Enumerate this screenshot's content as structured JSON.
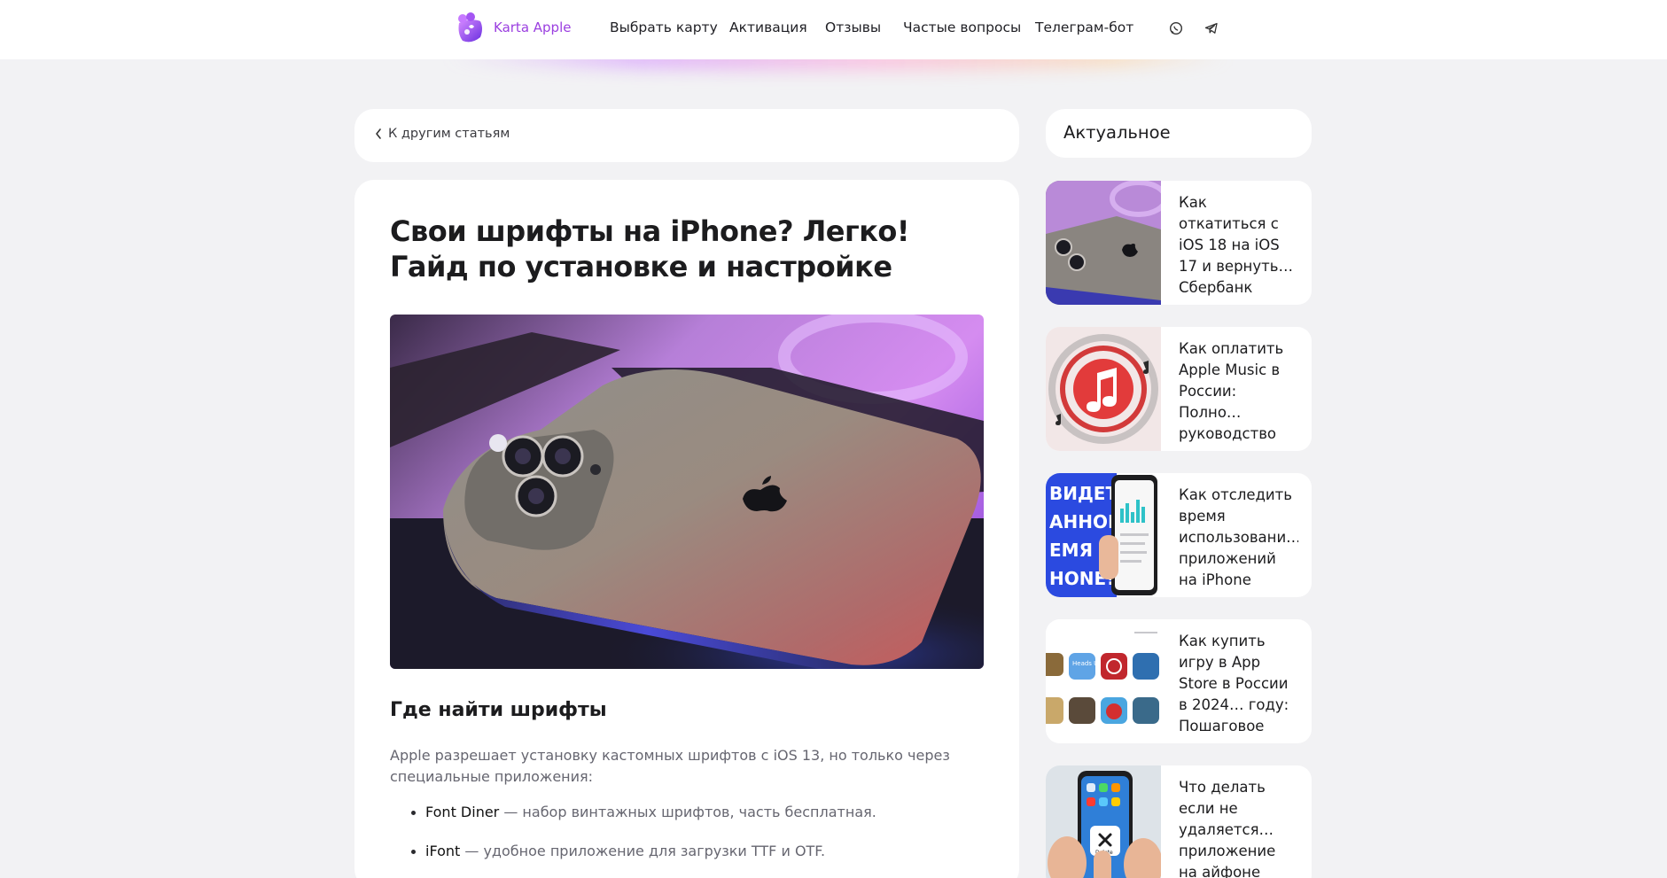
{
  "header": {
    "brand": "Karta Apple",
    "nav": [
      "Выбрать карту",
      "Активация",
      "Отзывы",
      "Частые вопросы",
      "Телеграм-бот"
    ],
    "social_icons": [
      "whatsapp-icon",
      "telegram-icon"
    ]
  },
  "back_link": "К другим статьям",
  "article": {
    "title": "Свои шрифты на iPhone? Легко! Гайд по установке и настройке",
    "section_heading": "Где найти шрифты",
    "paragraph": "Apple разрешает установку кастомных шрифтов с iOS 13, но только через специальные приложения:",
    "bullets": [
      {
        "name": "Font Diner",
        "text": " — набор винтажных шрифтов, часть бесплатная."
      },
      {
        "name": "iFont",
        "text": " — удобное приложение для загрузки TTF и OTF."
      }
    ]
  },
  "sidebar": {
    "title": "Актуальное",
    "items": [
      {
        "title": "Как откатиться с iOS 18 на iOS 17 и вернуть… Сбербанк Онлайн на"
      },
      {
        "title": "Как оплатить Apple Music в России: Полно… руководство для"
      },
      {
        "title": "Как отследить время использовани… приложений на iPhone"
      },
      {
        "title": "Как купить игру в App Store в России в 2024… году: Пошаговое"
      },
      {
        "title": "Что делать если не удаляется… приложение на айфоне"
      }
    ]
  },
  "thumb_text": {
    "screen_time_banner": [
      "ВИДЕТЬ",
      "АННОЕ",
      "ЕМЯ",
      "HONE?"
    ],
    "delete_label": "Delete",
    "heads_up_label": "Heads Up!"
  },
  "colors": {
    "brand": "#9b3fe0",
    "page_bg": "#f2f2f4",
    "card_bg": "#ffffff"
  }
}
